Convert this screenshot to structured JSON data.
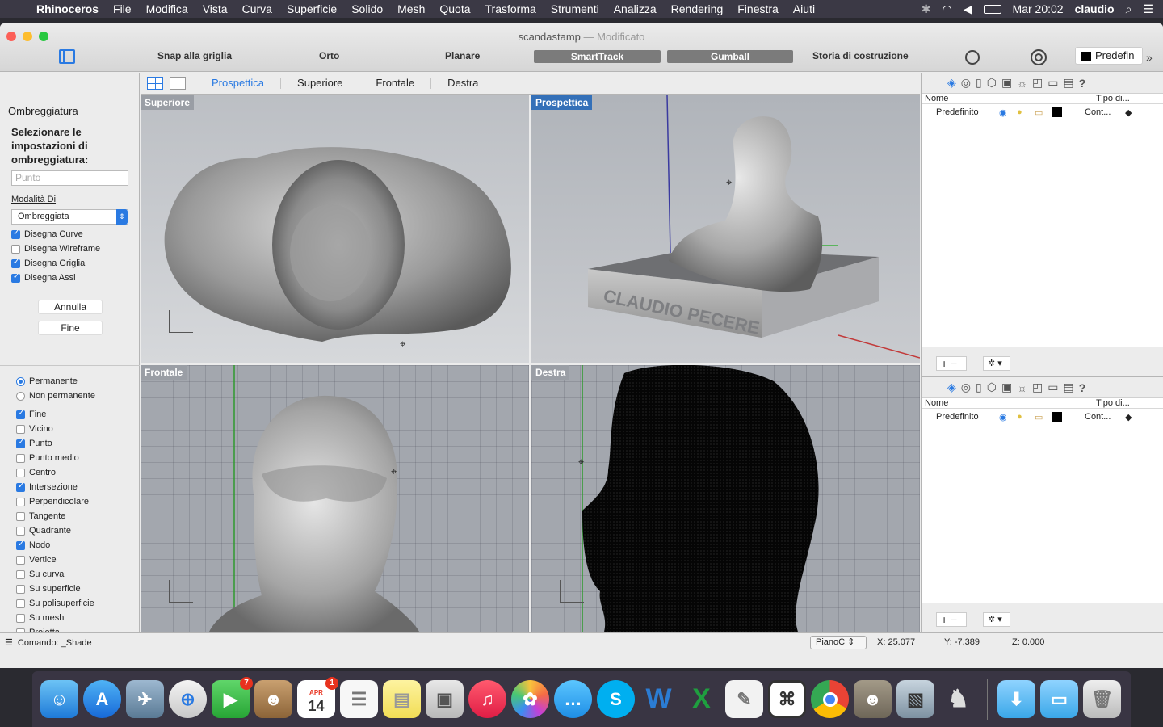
{
  "menubar": {
    "app_name": "Rhinoceros",
    "items": [
      "File",
      "Modifica",
      "Vista",
      "Curva",
      "Superficie",
      "Solido",
      "Mesh",
      "Quota",
      "Trasforma",
      "Strumenti",
      "Analizza",
      "Rendering",
      "Finestra",
      "Aiuti"
    ],
    "clock": "Mar 20:02",
    "user": "claudio"
  },
  "window": {
    "title": "scandastamp",
    "subtitle": "Modificato"
  },
  "toolbar": {
    "snap_grid": "Snap alla griglia",
    "ortho": "Orto",
    "planar": "Planare",
    "smarttrack": "SmartTrack",
    "gumball": "Gumball",
    "history": "Storia di costruzione",
    "layer_default": "Predefin"
  },
  "left_panel": {
    "title": "Ombreggiatura",
    "prompt": "Selezionare le impostazioni di ombreggiatura:",
    "input_placeholder": "Punto",
    "mode_label": "Modalità Di",
    "mode_value": "Ombreggiata",
    "options": [
      {
        "label": "Disegna Curve",
        "checked": true
      },
      {
        "label": "Disegna Wireframe",
        "checked": false
      },
      {
        "label": "Disegna Griglia",
        "checked": true
      },
      {
        "label": "Disegna Assi",
        "checked": true
      }
    ],
    "cancel": "Annulla",
    "done": "Fine"
  },
  "osnap": {
    "permanent": "Permanente",
    "non_permanent": "Non permanente",
    "items": [
      {
        "label": "Fine",
        "checked": true
      },
      {
        "label": "Vicino",
        "checked": false
      },
      {
        "label": "Punto",
        "checked": true
      },
      {
        "label": "Punto medio",
        "checked": false
      },
      {
        "label": "Centro",
        "checked": false
      },
      {
        "label": "Intersezione",
        "checked": true
      },
      {
        "label": "Perpendicolare",
        "checked": false
      },
      {
        "label": "Tangente",
        "checked": false
      },
      {
        "label": "Quadrante",
        "checked": false
      },
      {
        "label": "Nodo",
        "checked": true
      },
      {
        "label": "Vertice",
        "checked": false
      },
      {
        "label": "Su curva",
        "checked": false
      },
      {
        "label": "Su superficie",
        "checked": false
      },
      {
        "label": "Su polisuperficie",
        "checked": false
      },
      {
        "label": "Su mesh",
        "checked": false
      },
      {
        "label": "Proietta",
        "checked": false
      }
    ]
  },
  "viewport_tabs": [
    "Prospettica",
    "Superiore",
    "Frontale",
    "Destra"
  ],
  "viewports": {
    "top": "Superiore",
    "perspective": "Prospettica",
    "front": "Frontale",
    "right": "Destra",
    "base_text": "CLAUDIO PECERE"
  },
  "layers": {
    "col_name": "Nome",
    "col_type": "Tipo di...",
    "row_name": "Predefinito",
    "row_type": "Cont..."
  },
  "status": {
    "command": "Comando: _Shade",
    "plane": "PianoC",
    "x": "X: 25.077",
    "y": "Y: -7.389",
    "z": "Z: 0.000"
  },
  "dock": {
    "facetime_badge": "7",
    "calendar_badge": "1",
    "calendar_month": "APR",
    "calendar_day": "14"
  },
  "colors": {
    "accent": "#2a7ae2",
    "menubar": "#3b3945",
    "viewport_bg": "#a9adb4",
    "active_label": "#3470b8"
  }
}
